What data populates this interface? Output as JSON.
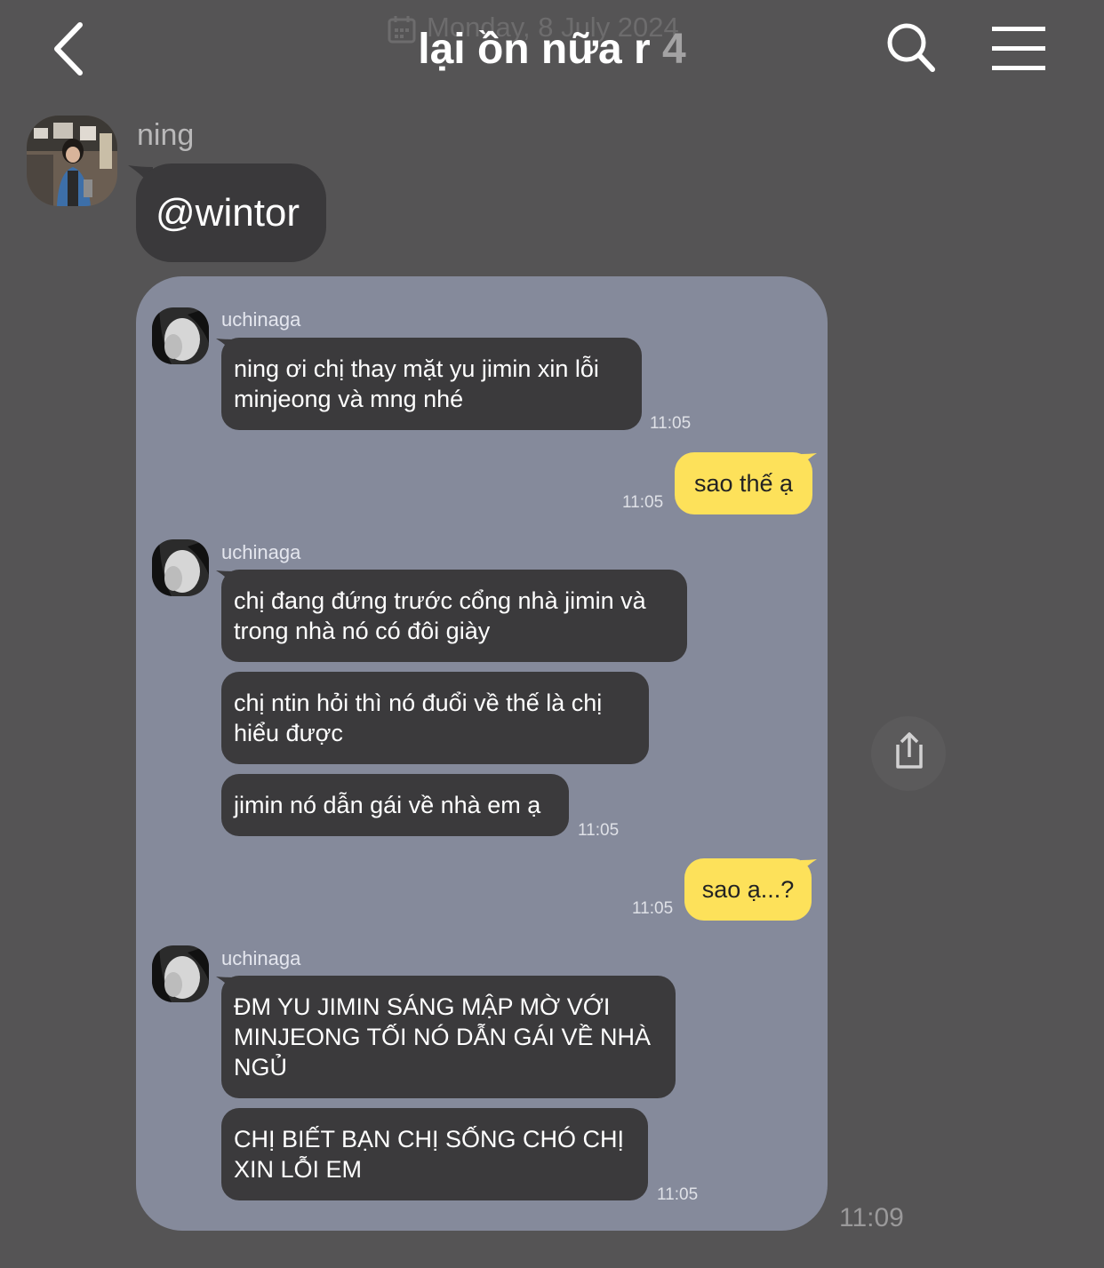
{
  "header": {
    "date_label": "Monday, 8 July 2024",
    "title": "lại ồn nữa r",
    "member_count": "4"
  },
  "message": {
    "sender": "ning",
    "text": "@wintor",
    "time": "11:09"
  },
  "shared_chat": {
    "messages": [
      {
        "sender": "uchinaga",
        "text": "ning ơi chị thay mặt yu jimin xin lỗi minjeong và mng nhé",
        "time": "11:05"
      },
      {
        "me": true,
        "text": "sao thế ạ",
        "time": "11:05"
      },
      {
        "sender": "uchinaga",
        "texts": [
          "chị đang đứng trước cổng nhà jimin và trong nhà nó có đôi giày",
          "chị ntin hỏi thì nó đuổi về thế là chị hiểu được",
          "jimin nó dẫn gái về nhà em ạ"
        ],
        "time": "11:05"
      },
      {
        "me": true,
        "text": "sao ạ...?",
        "time": "11:05"
      },
      {
        "sender": "uchinaga",
        "texts": [
          "ĐM YU JIMIN SÁNG MẬP MỜ VỚI MINJEONG TỐI NÓ DẪN GÁI VỀ NHÀ NGỦ",
          "CHỊ BIẾT BẠN CHỊ SỐNG CHÓ CHỊ XIN LỖI EM"
        ],
        "time": "11:05"
      }
    ]
  },
  "icons": {
    "back": "chevron-left-icon",
    "search": "search-icon",
    "menu": "hamburger-menu-icon",
    "share": "share-icon",
    "date": "calendar-icon"
  },
  "colors": {
    "background": "#555455",
    "dark_bubble": "#3a393b",
    "card_background": "#858a9b",
    "my_bubble": "#fde15a",
    "title": "#ffffff"
  }
}
